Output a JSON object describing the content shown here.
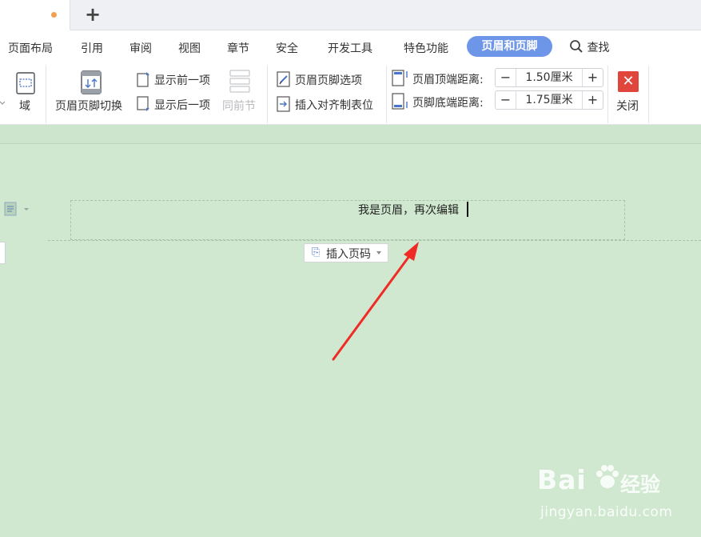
{
  "tabbar": {
    "new_tab_symbol": "+",
    "modified_dot_color": "#f0a050"
  },
  "menu": {
    "items": [
      "页面布局",
      "引用",
      "审阅",
      "视图",
      "章节",
      "安全",
      "开发工具",
      "特色功能"
    ],
    "active": "页眉和页脚",
    "active_color": "#6e96e8",
    "search": "查找"
  },
  "ribbon": {
    "field_label": "域",
    "switch_label": "页眉页脚切换",
    "show_prev": "显示前一项",
    "show_next": "显示后一项",
    "same_section": "同前节",
    "options": "页眉页脚选项",
    "insert_tab": "插入对齐制表位",
    "top_dist_label": "页眉顶端距离:",
    "top_dist_value": "1.50厘米",
    "bottom_dist_label": "页脚底端距离:",
    "bottom_dist_value": "1.75厘米",
    "minus": "−",
    "plus": "+",
    "close_label": "关闭",
    "close_color": "#e0463b"
  },
  "document": {
    "header_text": "我是页眉，再次编辑",
    "insert_page_number": "插入页码",
    "background_color": "#cfe8cf"
  },
  "watermark": {
    "brand": "Bai",
    "brand_tail": "经验",
    "url": "jingyan.baidu.com"
  }
}
